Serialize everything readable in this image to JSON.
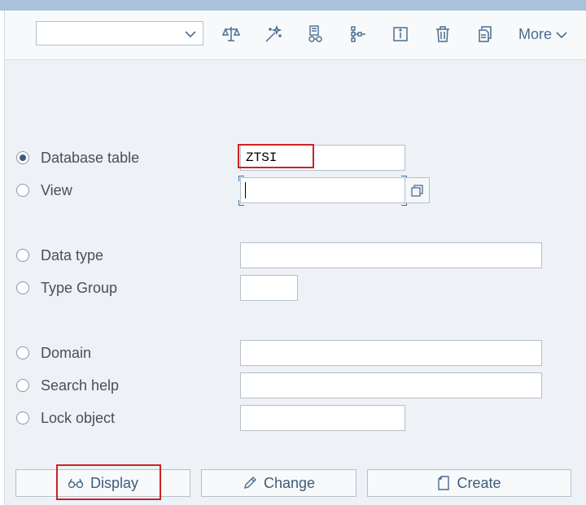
{
  "toolbar": {
    "dropdown_value": "",
    "icons": [
      "compare-icon",
      "magic-wand-icon",
      "where-used-icon",
      "hierarchy-icon",
      "info-icon",
      "delete-icon",
      "copy-icon"
    ],
    "more_label": "More"
  },
  "options": {
    "database_table": {
      "label": "Database table",
      "value": "ZTSI",
      "selected": true
    },
    "view": {
      "label": "View",
      "value": ""
    },
    "data_type": {
      "label": "Data type",
      "value": ""
    },
    "type_group": {
      "label": "Type Group",
      "value": ""
    },
    "domain": {
      "label": "Domain",
      "value": ""
    },
    "search_help": {
      "label": "Search help",
      "value": ""
    },
    "lock_object": {
      "label": "Lock object",
      "value": ""
    }
  },
  "buttons": {
    "display": "Display",
    "change": "Change",
    "create": "Create"
  },
  "colors": {
    "accent": "#4a6d8f",
    "highlight": "#cc2222",
    "background": "#eef2f6"
  }
}
